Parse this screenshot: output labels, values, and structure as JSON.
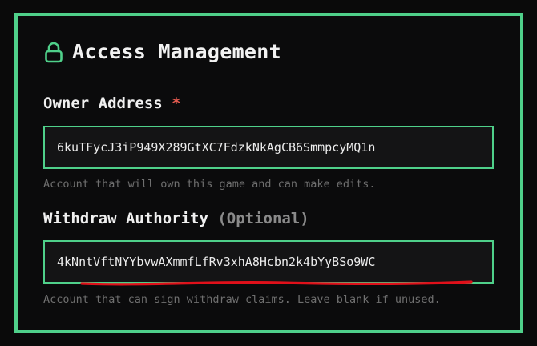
{
  "section": {
    "title": "Access Management",
    "icon": "lock-icon"
  },
  "owner": {
    "label": "Owner Address",
    "required_marker": "*",
    "value": "6kuTFycJ3iP949X289GtXC7FdzkNkAgCB6SmmpcyMQ1n",
    "hint": "Account that will own this game and can make edits."
  },
  "withdraw": {
    "label": "Withdraw Authority",
    "optional_label": "(Optional)",
    "value": "4kNntVftNYYbvwAXmmfLfRv3xhA8Hcbn2k4bYyBSo9WC",
    "hint": "Account that can sign withdraw claims. Leave blank if unused."
  },
  "colors": {
    "accent": "#4fd08a",
    "required": "#e35a4f",
    "annotation": "#e0101a"
  }
}
